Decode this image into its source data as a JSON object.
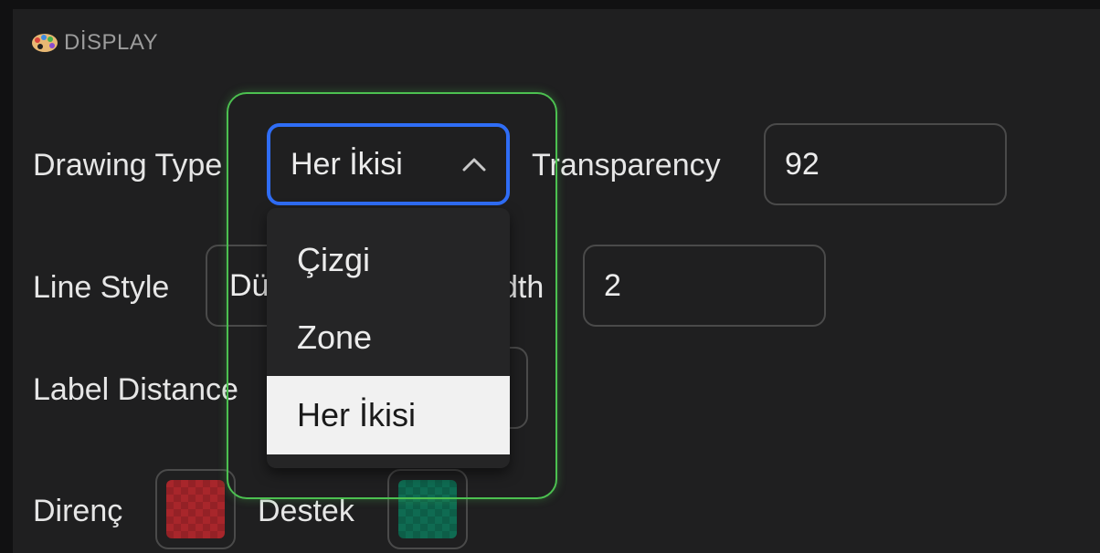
{
  "section": {
    "icon": "palette-icon",
    "title": "DİSPLAY"
  },
  "drawing_type": {
    "label": "Drawing Type",
    "value": "Her İkisi",
    "options": [
      "Çizgi",
      "Zone",
      "Her İkisi"
    ],
    "selected_index": 2
  },
  "transparency": {
    "label": "Transparency",
    "value": "92"
  },
  "line_style": {
    "label": "Line Style",
    "value_visible": "Dü"
  },
  "line_width": {
    "label_visible": "dth",
    "value": "2"
  },
  "label_distance": {
    "label": "Label Distance"
  },
  "colors": {
    "direnc": {
      "label": "Direnç",
      "color": "#a8262b"
    },
    "destek": {
      "label": "Destek",
      "color": "#0f6b52"
    }
  },
  "accent": {
    "focus": "#2f6df6",
    "highlight": "#4cc050"
  }
}
